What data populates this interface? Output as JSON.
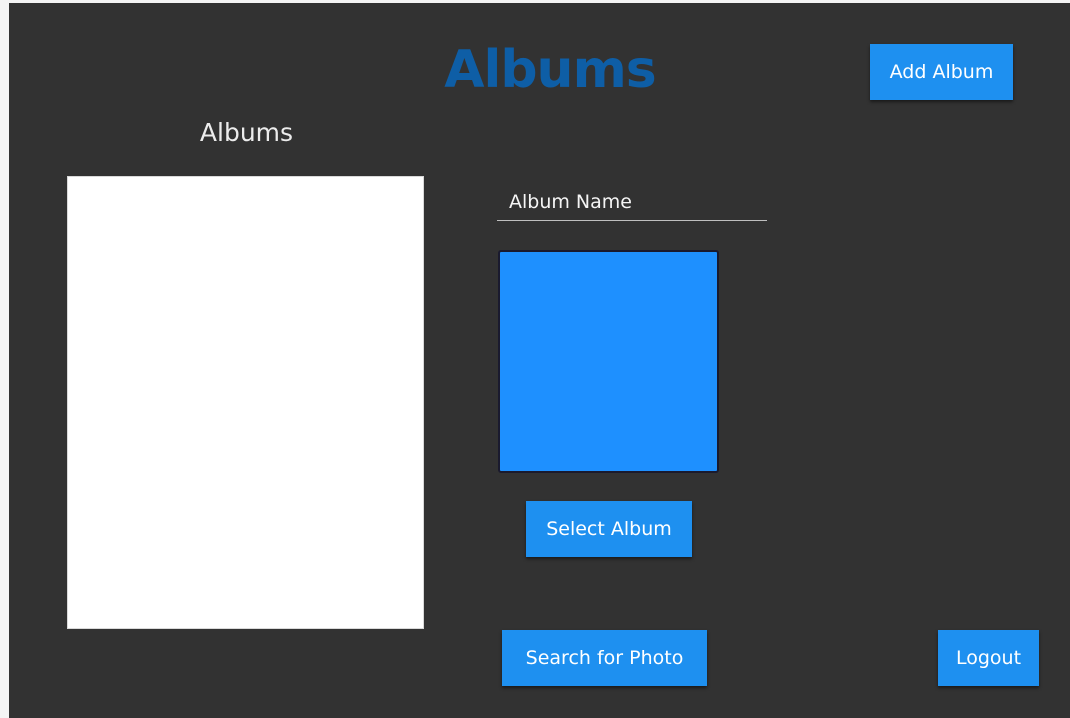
{
  "header": {
    "title": "Albums",
    "add_album_label": "Add Album"
  },
  "albums_panel": {
    "heading": "Albums",
    "items": []
  },
  "detail": {
    "album_name_placeholder": "Album Name",
    "album_name_value": "",
    "select_album_label": "Select Album"
  },
  "footer": {
    "search_photo_label": "Search for Photo",
    "logout_label": "Logout"
  },
  "colors": {
    "background": "#323232",
    "title": "#0e5ea6",
    "button": "#1e90f0",
    "preview": "#1e90ff",
    "list_background": "#ffffff"
  }
}
